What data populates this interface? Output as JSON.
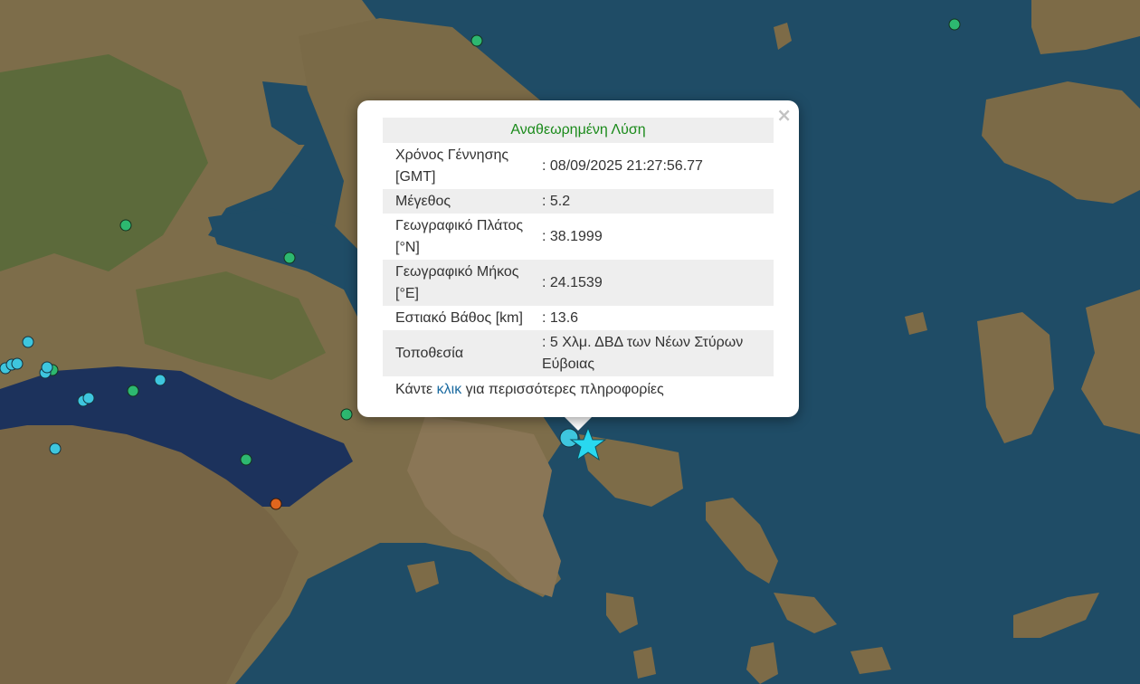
{
  "popup": {
    "header": "Αναθεωρημένη Λύση",
    "close_symbol": "×",
    "rows": [
      {
        "label": "Χρόνος Γέννησης [GMT]",
        "value": ": 08/09/2025 21:27:56.77"
      },
      {
        "label": "Μέγεθος",
        "value": ": 5.2"
      },
      {
        "label": "Γεωγραφικό Πλάτος [°N]",
        "value": ": 38.1999"
      },
      {
        "label": "Γεωγραφικό Μήκος [°E]",
        "value": ": 24.1539"
      },
      {
        "label": "Εστιακό Βάθος [km]",
        "value": ": 13.6"
      },
      {
        "label": "Τοποθεσία",
        "value": ": 5 Χλμ. ΔΒΔ των Νέων Στύρων Εύβοιας"
      }
    ],
    "footer_prefix": "Κάντε",
    "footer_link": "κλικ",
    "footer_suffix": "για περισσότερες πληροφορίες"
  },
  "map": {
    "marker_colors": {
      "green": "#2db870",
      "cyan": "#3ec6de",
      "orange": "#e0661e",
      "epicenter": "#29d8ef"
    },
    "land_color": "#7a6a48",
    "sea_color": "#1e4a64",
    "gulf_color": "#1a2f5a"
  }
}
